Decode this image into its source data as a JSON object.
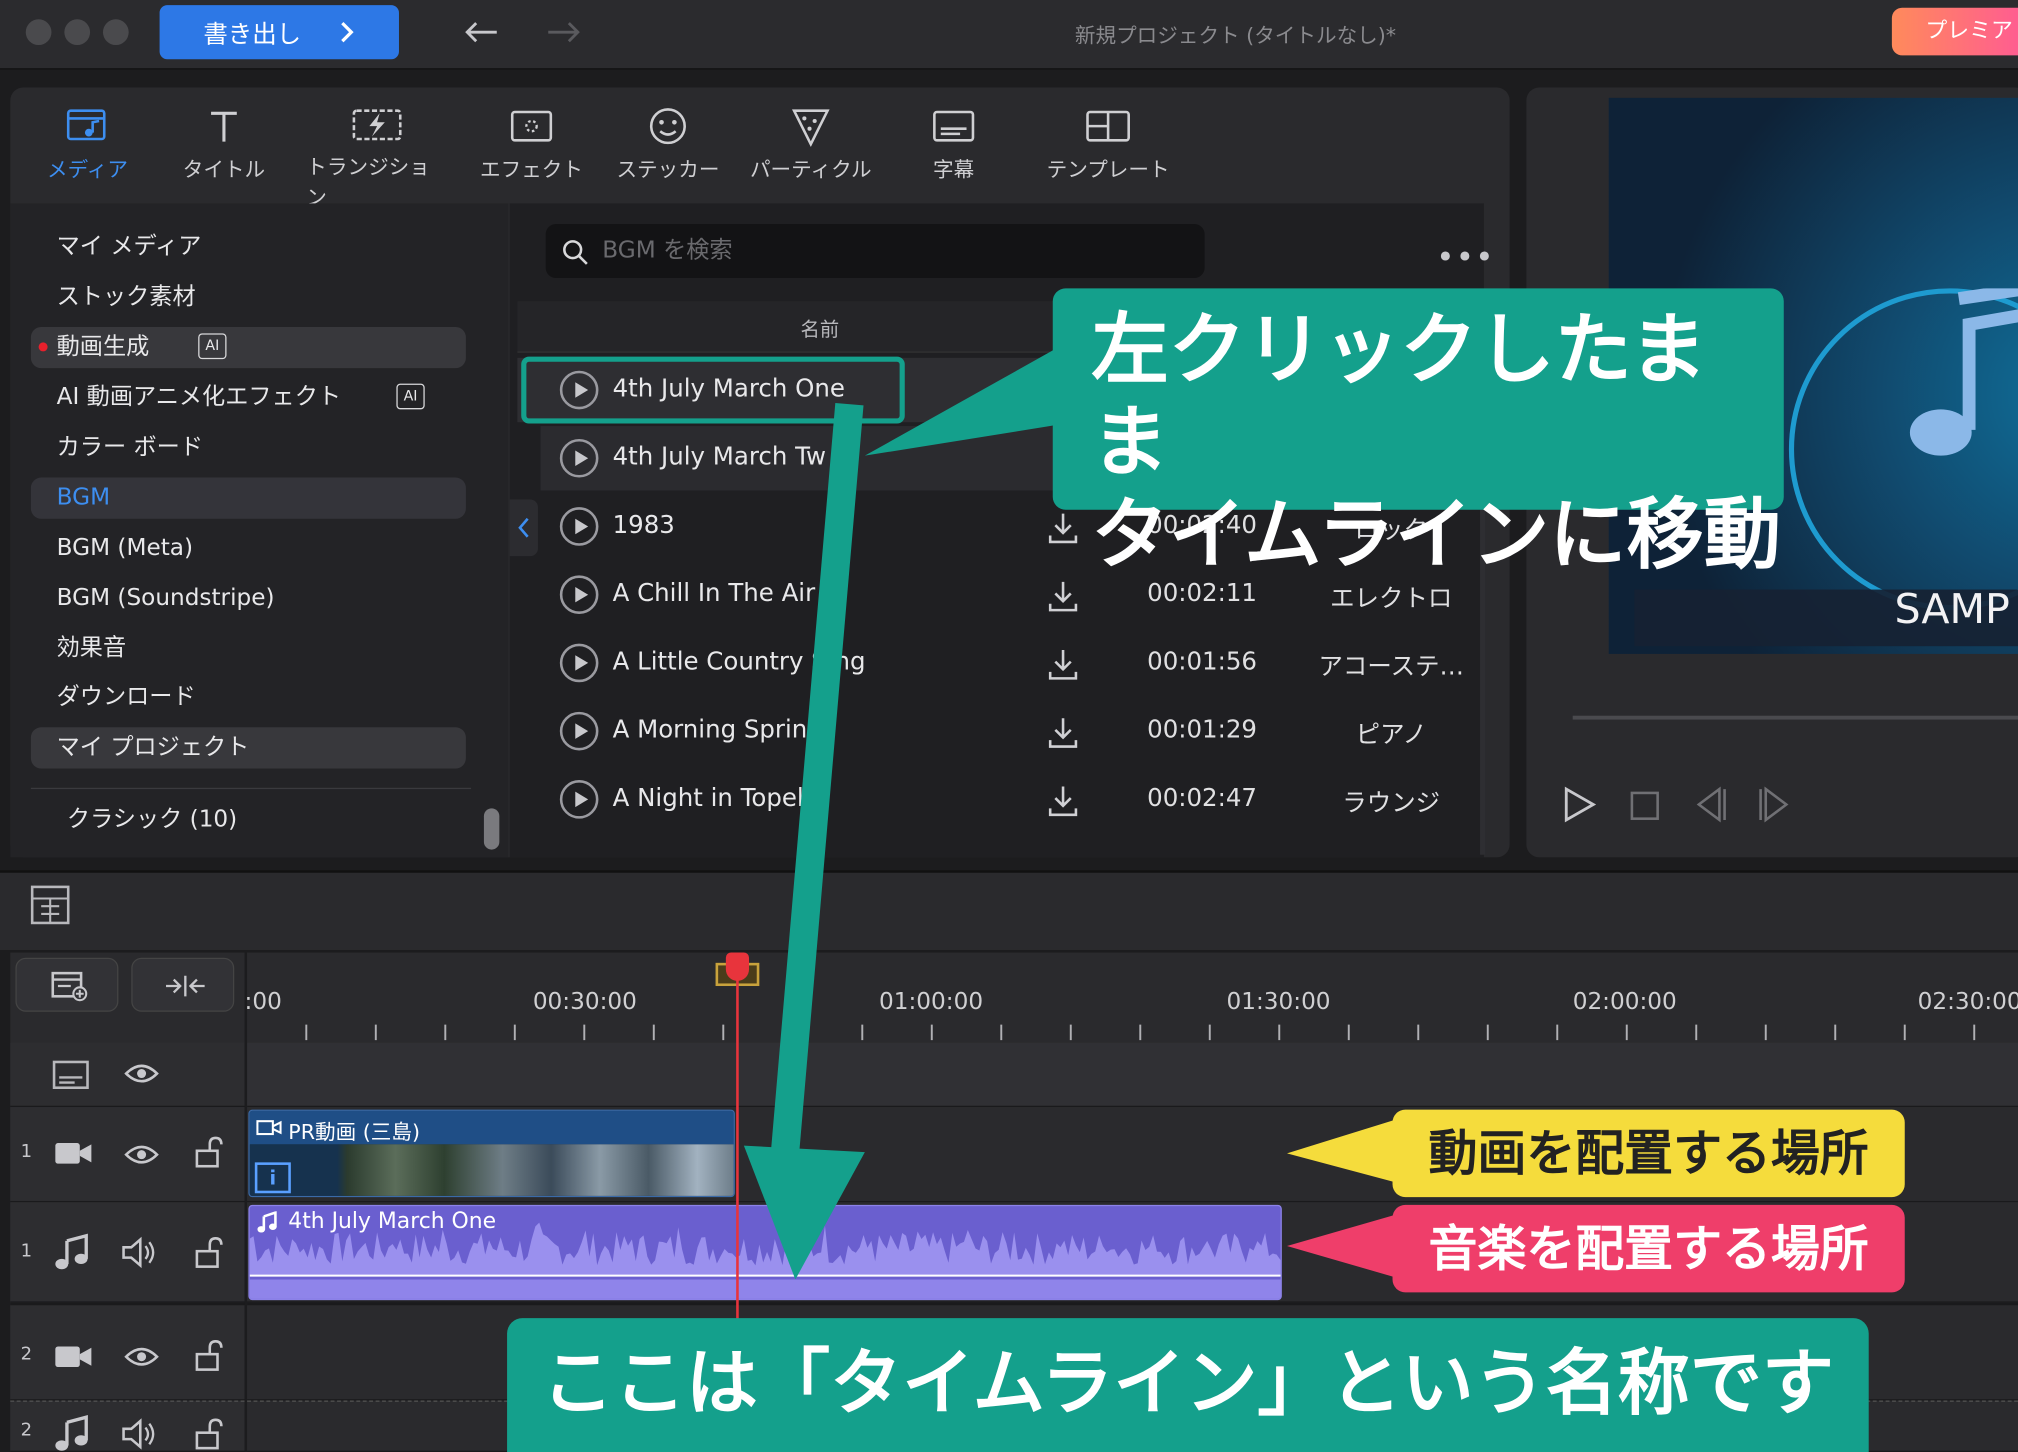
{
  "window": {
    "title": "新規プロジェクト (タイトルなし)*",
    "export_label": "書き出し",
    "premium_label": "プレミア"
  },
  "toolbar": {
    "items": [
      {
        "label": "メディア",
        "icon": "media-icon",
        "active": true
      },
      {
        "label": "タイトル",
        "icon": "title-icon"
      },
      {
        "label": "トランジション",
        "icon": "transition-icon"
      },
      {
        "label": "エフェクト",
        "icon": "effect-icon"
      },
      {
        "label": "ステッカー",
        "icon": "sticker-icon"
      },
      {
        "label": "パーティクル",
        "icon": "particle-icon"
      },
      {
        "label": "字幕",
        "icon": "subtitle-icon"
      },
      {
        "label": "テンプレート",
        "icon": "template-icon"
      }
    ]
  },
  "sidebar": {
    "items": [
      {
        "label": "マイ メディア"
      },
      {
        "label": "ストック素材"
      },
      {
        "label": "動画生成",
        "badge": "AI"
      },
      {
        "label": "AI 動画アニメ化エフェクト",
        "badge": "AI"
      },
      {
        "label": "カラー ボード"
      },
      {
        "label": "BGM",
        "selected": true
      },
      {
        "label": "BGM (Meta)"
      },
      {
        "label": "BGM (Soundstripe)"
      },
      {
        "label": "効果音"
      },
      {
        "label": "ダウンロード"
      },
      {
        "label": "マイ プロジェクト"
      }
    ],
    "category": "クラシック (10)"
  },
  "library": {
    "search_placeholder": "BGM を検索",
    "column_name": "名前",
    "tracks": [
      {
        "title": "4th July March One",
        "duration": "",
        "genre": ""
      },
      {
        "title": "4th July March Tw",
        "duration": "",
        "genre": ""
      },
      {
        "title": "1983",
        "duration": "00:02:40",
        "genre": "ロック"
      },
      {
        "title": "A Chill In The Air",
        "duration": "00:02:11",
        "genre": "エレクトロ"
      },
      {
        "title": "A Little Country S   ng",
        "duration": "00:01:56",
        "genre": "アコーステ…"
      },
      {
        "title": "A Morning Sprin",
        "duration": "00:01:29",
        "genre": "ピアノ"
      },
      {
        "title": "A Night in Topek",
        "duration": "00:02:47",
        "genre": "ラウンジ"
      }
    ]
  },
  "preview": {
    "sample_text": "SAMP"
  },
  "timeline": {
    "ticks": [
      ":00",
      "00:30:00",
      "01:00:00",
      "01:30:00",
      "02:00:00",
      "02:30:00"
    ],
    "video_clip_label": "PR動画 (三島)",
    "audio_clip_label": "4th July March One",
    "tracks": [
      {
        "num": "1",
        "kind": "video"
      },
      {
        "num": "1",
        "kind": "audio"
      },
      {
        "num": "2",
        "kind": "video"
      },
      {
        "num": "2",
        "kind": "audio"
      }
    ]
  },
  "annotations": {
    "drag_line1": "左クリックしたまま",
    "drag_line2": "タイムラインに移動",
    "video_place": "動画を配置する場所",
    "music_place": "音楽を配置する場所",
    "timeline_name": "ここは「タイムライン」という名称です"
  },
  "colors": {
    "accent": "#3d8ef0",
    "teal": "#14a08c",
    "yellow": "#f5dc3c",
    "pink": "#ef3e6a",
    "audio_clip": "#6a5fcf",
    "video_clip_header": "#1f4e86"
  }
}
